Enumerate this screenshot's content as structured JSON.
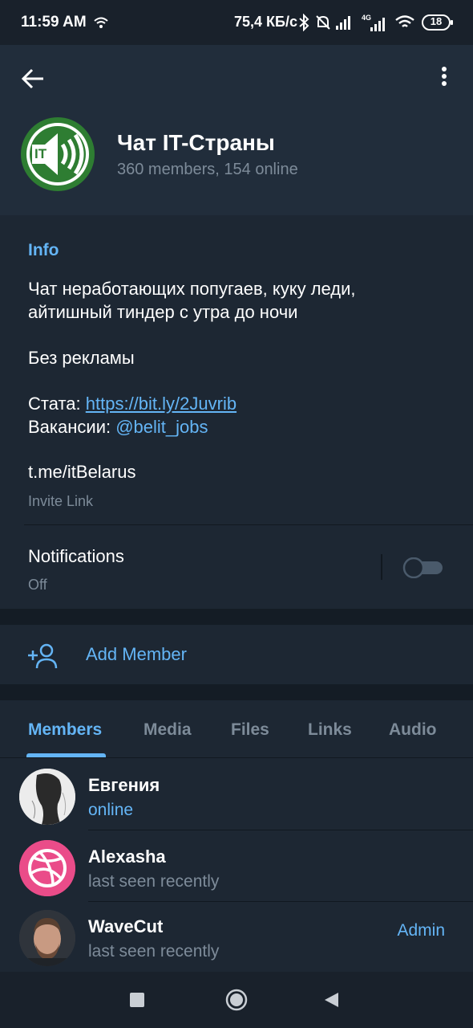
{
  "status_bar": {
    "time": "11:59 AM",
    "network_speed": "75,4 КБ/с",
    "battery": "18",
    "network_type": "4G"
  },
  "header": {
    "title": "Чат IT-Страны",
    "subtitle": "360 members, 154 online",
    "avatar_text": "IT"
  },
  "info": {
    "heading": "Info",
    "description_line1": "Чат неработающих попугаев, куку леди,",
    "description_line2": "айтишный тиндер с утра до ночи",
    "no_ads": "Без рекламы",
    "stats_label": "Стата: ",
    "stats_link": "https://bit.ly/2Juvrib",
    "jobs_label": "Вакансии: ",
    "jobs_mention": "@belit_jobs",
    "invite_link": "t.me/itBelarus",
    "invite_link_caption": "Invite Link"
  },
  "notifications": {
    "label": "Notifications",
    "value": "Off",
    "enabled": false
  },
  "add_member": {
    "label": "Add Member"
  },
  "tabs": [
    {
      "label": "Members",
      "active": true
    },
    {
      "label": "Media",
      "active": false
    },
    {
      "label": "Files",
      "active": false
    },
    {
      "label": "Links",
      "active": false
    },
    {
      "label": "Audio",
      "active": false
    }
  ],
  "members": [
    {
      "name": "Евгения",
      "status": "online",
      "role": ""
    },
    {
      "name": "Alexasha",
      "status": "last seen recently",
      "role": ""
    },
    {
      "name": "WaveCut",
      "status": "last seen recently",
      "role": "Admin"
    }
  ],
  "colors": {
    "accent": "#64b5f6",
    "background": "#1d2733",
    "header_background": "#212d3b",
    "muted_text": "#7d8b99",
    "avatar_green": "#2e7d32",
    "dribbble_pink": "#ea4c89"
  }
}
